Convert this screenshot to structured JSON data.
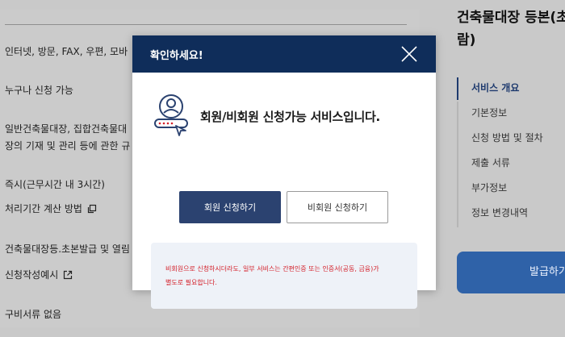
{
  "background": {
    "rows": [
      "인터넷, 방문, FAX, 우편, 모바",
      "누구나 신청 가능",
      "일반건축물대장, 집합건축물대",
      "장의 기재 및 관리 등에 관한 규",
      "즉시(근무시간 내 3시간)",
      "처리기간 계산 방법",
      "건축물대장등.초본발급 및 열림",
      "신청작성예시",
      "구비서류 없음"
    ]
  },
  "sidebar": {
    "title_line1": "건축물대장 등본(초",
    "title_line2": "람)",
    "items": [
      {
        "label": "서비스 개요"
      },
      {
        "label": "기본정보"
      },
      {
        "label": "신청 방법 및 절차"
      },
      {
        "label": "제출 서류"
      },
      {
        "label": "부가정보"
      },
      {
        "label": "정보 변경내역"
      }
    ],
    "issue_button": "발급하기"
  },
  "modal": {
    "title": "확인하세요!",
    "message": "회원/비회원 신청가능 서비스입니다.",
    "member_button": "회원 신청하기",
    "nonmember_button": "비회원 신청하기",
    "info_line1": "비회원으로 신청하시더라도, 일부 서비스는 간편인증 또는 인증서(공동, 금융)가",
    "info_line2": "별도로 필요합니다."
  },
  "colors": {
    "header": "#0f2d5a",
    "member_button": "#2b4270",
    "warning_text": "#d4202a",
    "issue_button": "#2f62a8"
  }
}
